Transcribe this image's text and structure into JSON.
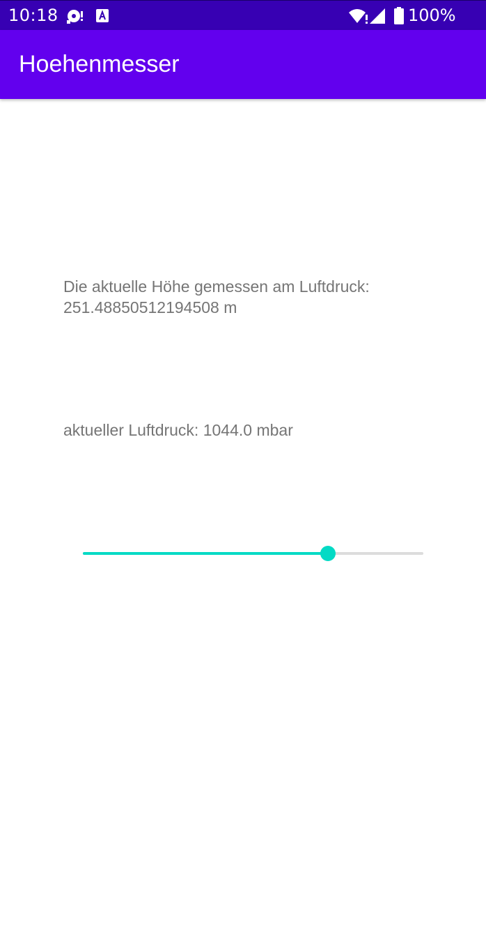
{
  "status_bar": {
    "time": "10:18",
    "battery": "100%",
    "icons": [
      "media-notification-icon",
      "accessibility-notification-icon",
      "wifi-icon",
      "signal-icon",
      "battery-icon"
    ]
  },
  "app_bar": {
    "title": "Hoehenmesser"
  },
  "main": {
    "height_label": "Die aktuelle Höhe gemessen am Luftdruck: 251.48850512194508 m",
    "pressure_label": "aktueller Luftdruck: 1044.0 mbar",
    "slider": {
      "value_fraction": 0.72
    }
  },
  "colors": {
    "status_bar": "#3700b3",
    "app_bar": "#6200ee",
    "accent": "#03dac5",
    "text": "#757575",
    "track": "#dcdcdc"
  }
}
